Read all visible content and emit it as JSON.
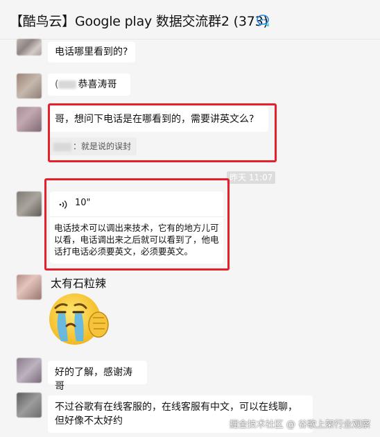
{
  "header": {
    "title": "【酷鸟云】Google play 数据交流群2 (373)",
    "icon": "group-chat-icon"
  },
  "messages": [
    {
      "text": "电话哪里看到的?"
    },
    {
      "text": "恭喜涛哥",
      "prefix": "("
    },
    {
      "text": "哥，想问下电话是在哪看到的，需要讲英文么?",
      "quote": "：就是说的误封",
      "highlighted": true
    },
    {
      "time": "昨天 11:07"
    },
    {
      "voice_duration": "10\"",
      "transcript": "电话技术可以调出来技术，它有的地方儿可以看，电话调出来之后就可以看到了，他电话打电话必须要英文，必须要英文。",
      "highlighted": true
    },
    {
      "sticker_label": "太有石粒辣",
      "sticker": "crying-face-sticker"
    },
    {
      "text": "好的了解，感谢涛哥"
    },
    {
      "text": "不过谷歌有在线客服的，在线客服有中文，可以在线聊，但好像不太好约"
    }
  ],
  "watermark": "掘金技术社区 @ 谷歌上架行业观察",
  "colors": {
    "highlight": "#e5202a",
    "background": "#f5f5f5",
    "bubble": "#ffffff"
  }
}
